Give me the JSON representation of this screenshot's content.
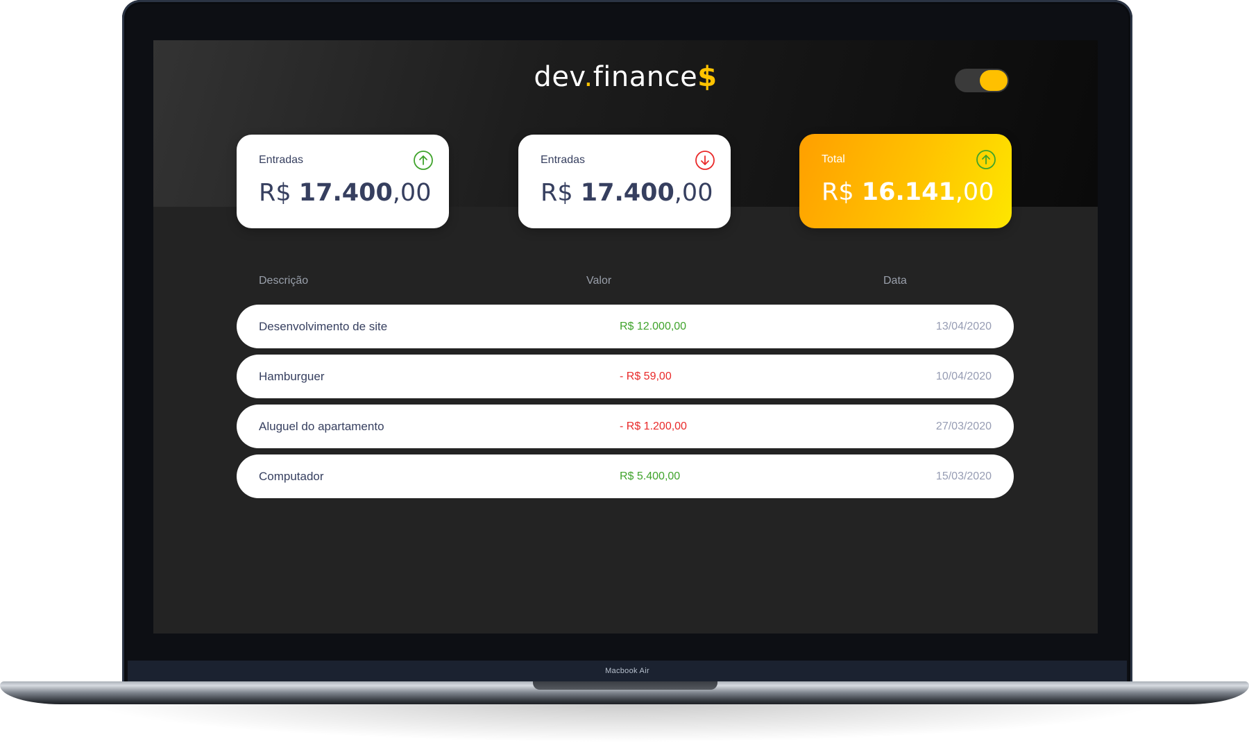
{
  "app": {
    "logo": {
      "prefix": "dev",
      "dot": ".",
      "suffix": "finance",
      "symbol": "$"
    },
    "theme_toggle": {
      "state": "on"
    }
  },
  "summary": [
    {
      "label": "Entradas",
      "currency": "R$",
      "integer": "17.400",
      "decimal": ",00",
      "icon": "arrow-up-circle-icon",
      "icon_color": "#3fa32b"
    },
    {
      "label": "Entradas",
      "currency": "R$",
      "integer": "17.400",
      "decimal": ",00",
      "icon": "arrow-down-circle-icon",
      "icon_color": "#e92929"
    },
    {
      "label": "Total",
      "currency": "R$",
      "integer": "16.141",
      "decimal": ",00",
      "icon": "arrow-up-circle-icon",
      "icon_color": "#3fa32b"
    }
  ],
  "table": {
    "headers": {
      "description": "Descrição",
      "value": "Valor",
      "date": "Data"
    },
    "rows": [
      {
        "description": "Desenvolvimento de site",
        "value": "R$ 12.000,00",
        "type": "income",
        "date": "13/04/2020"
      },
      {
        "description": "Hamburguer",
        "value": "- R$ 59,00",
        "type": "expense",
        "date": "10/04/2020"
      },
      {
        "description": "Aluguel do apartamento",
        "value": "- R$ 1.200,00",
        "type": "expense",
        "date": "27/03/2020"
      },
      {
        "description": "Computador",
        "value": "R$ 5.400,00",
        "type": "income",
        "date": "15/03/2020"
      }
    ]
  },
  "device": {
    "label": "Macbook Air"
  },
  "colors": {
    "accent": "#ffc300",
    "income": "#3fa32b",
    "expense": "#e92929",
    "text": "#363f5f"
  }
}
